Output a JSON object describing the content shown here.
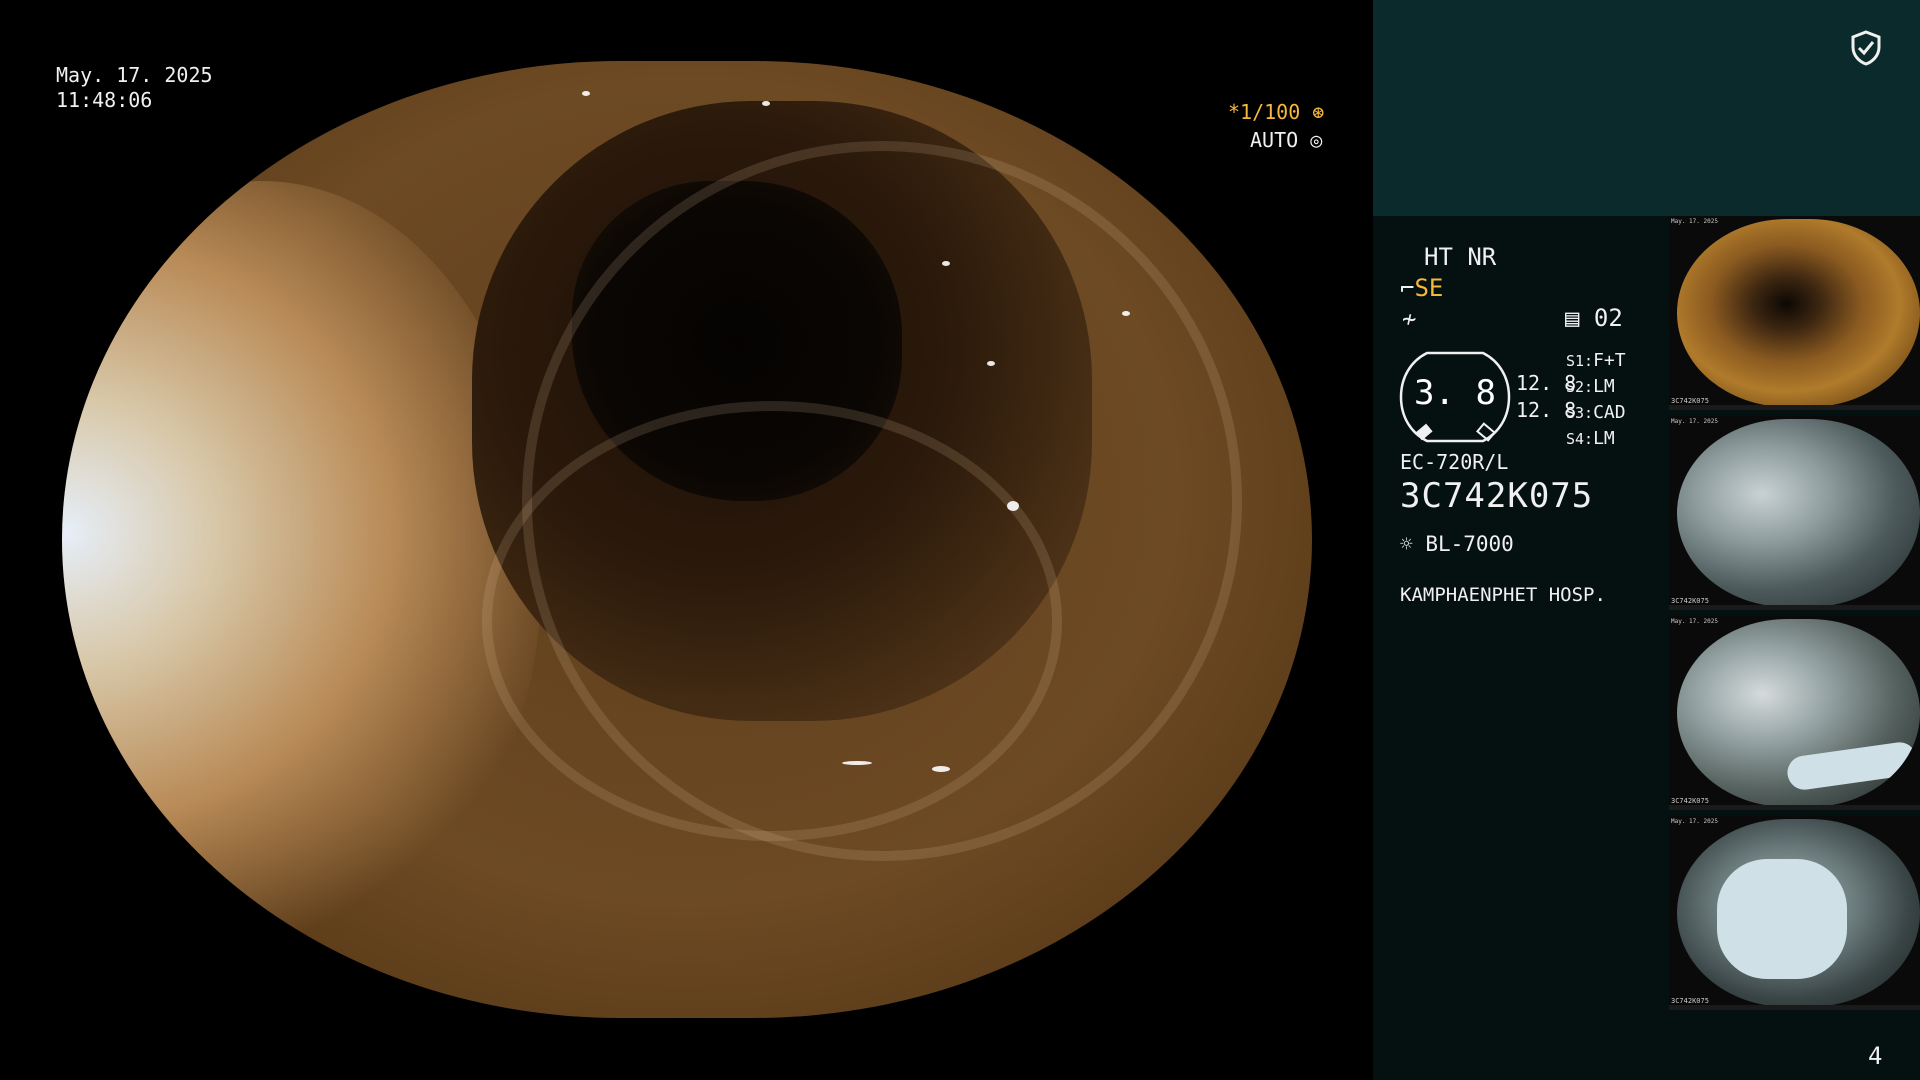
{
  "overlay": {
    "date": "May. 17. 2025",
    "time": "11:48:06",
    "shutter": "*1/100",
    "iris_mode": "AUTO"
  },
  "panel": {
    "ht_nr": "HT NR",
    "structure_mode": "SE",
    "memory": "02",
    "dial_value": "3. 8",
    "sub_values": [
      "12. 8",
      "12. 8"
    ],
    "switches": [
      {
        "label": "S1:",
        "value": "F+T"
      },
      {
        "label": "S2:",
        "value": "LM"
      },
      {
        "label": "S3:",
        "value": "CAD"
      },
      {
        "label": "S4:",
        "value": "LM"
      }
    ],
    "scope_model": "EC-720R/L",
    "scope_serial": "3C742K075",
    "light_source": "BL-7000",
    "hospital": "KAMPHAENPHET HOSP."
  },
  "thumbnails": [
    {
      "date": "May. 17. 2025",
      "serial": "3C742K075",
      "index": "1"
    },
    {
      "date": "May. 17. 2025",
      "serial": "3C742K075",
      "index": "2"
    },
    {
      "date": "May. 17. 2025",
      "serial": "3C742K075",
      "index": "3"
    },
    {
      "date": "May. 17. 2025",
      "serial": "3C742K075",
      "index": "4"
    }
  ],
  "page_number": "4",
  "colors": {
    "accent_orange": "#f5b73d",
    "panel_top": "#0a2a2c",
    "panel_bottom": "#051010"
  },
  "icons": [
    "shield-check-icon",
    "structure-enhance-icon",
    "color-enhance-icon",
    "memory-icon",
    "aperture-icon",
    "light-source-icon"
  ]
}
